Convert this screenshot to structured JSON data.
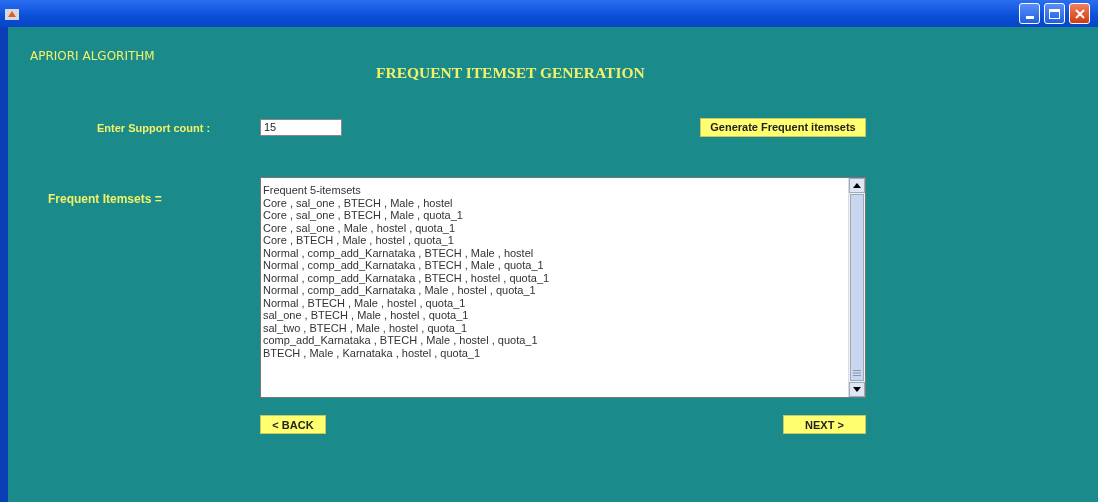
{
  "app_title": "APRIORI ALGORITHM",
  "heading": "FREQUENT ITEMSET GENERATION",
  "support": {
    "label": "Enter Support count :",
    "value": "15"
  },
  "generate_button": "Generate Frequent itemsets",
  "itemsets_label": "Frequent Itemsets =",
  "itemsets_lines": [
    "Frequent 5-itemsets",
    "Core , sal_one , BTECH , Male , hostel",
    "Core , sal_one , BTECH , Male , quota_1",
    "Core , sal_one , Male , hostel , quota_1",
    "Core , BTECH , Male , hostel , quota_1",
    "Normal , comp_add_Karnataka , BTECH , Male , hostel",
    "Normal , comp_add_Karnataka , BTECH , Male , quota_1",
    "Normal , comp_add_Karnataka , BTECH , hostel , quota_1",
    "Normal , comp_add_Karnataka , Male , hostel , quota_1",
    "Normal , BTECH , Male , hostel , quota_1",
    "sal_one , BTECH , Male , hostel , quota_1",
    "sal_two , BTECH , Male , hostel , quota_1",
    "comp_add_Karnataka , BTECH , Male , hostel , quota_1",
    "BTECH , Male , Karnataka , hostel , quota_1"
  ],
  "back_button": "< BACK",
  "next_button": "NEXT >"
}
